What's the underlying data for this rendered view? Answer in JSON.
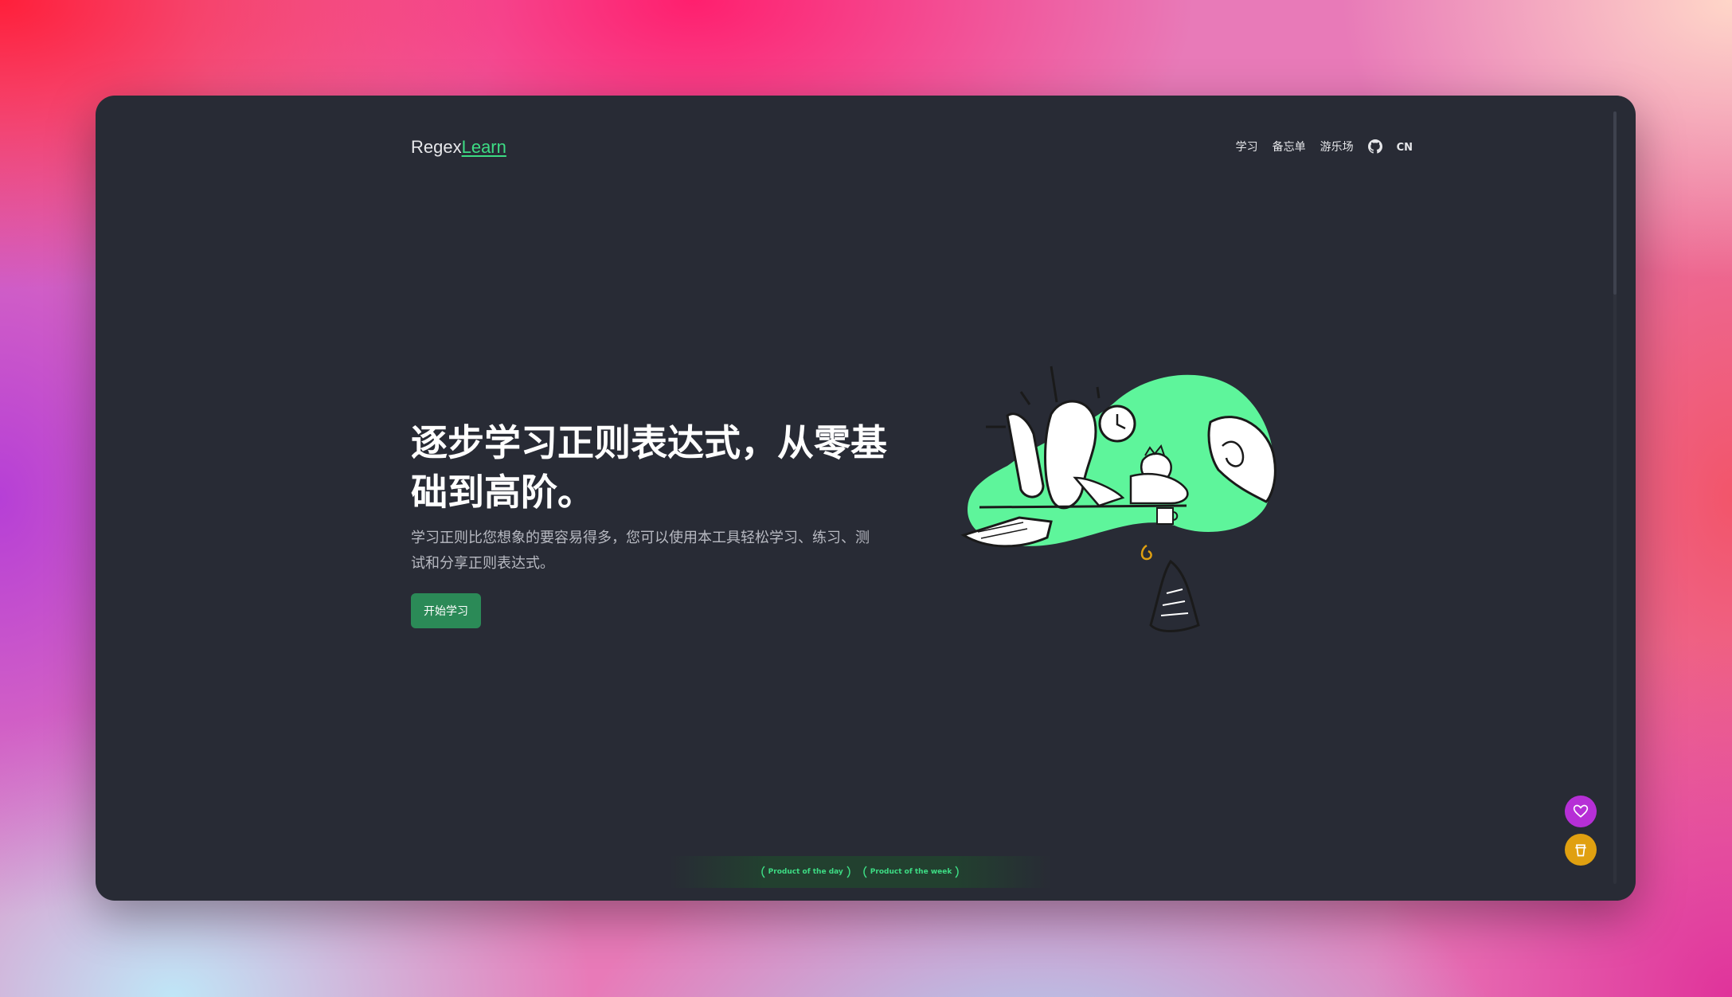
{
  "brand": {
    "prefix": "Regex",
    "accent": "Learn"
  },
  "nav": {
    "items": [
      "学习",
      "备忘单",
      "游乐场"
    ],
    "language": "CN"
  },
  "hero": {
    "title": "逐步学习正则表达式，从零基础到高阶。",
    "description": "学习正则比您想象的要容易得多，您可以使用本工具轻松学习、练习、测试和分享正则表达式。",
    "cta_label": "开始学习"
  },
  "badges": [
    "Product of the day",
    "Product of the week"
  ],
  "icons": {
    "github": "github-icon",
    "sponsor": "heart-icon",
    "coffee": "coffee-cup-icon"
  },
  "colors": {
    "background": "#282b35",
    "accent": "#3ddc84",
    "button": "#2b8a57",
    "sponsor": "#b62fd6",
    "coffee": "#e0a010"
  }
}
